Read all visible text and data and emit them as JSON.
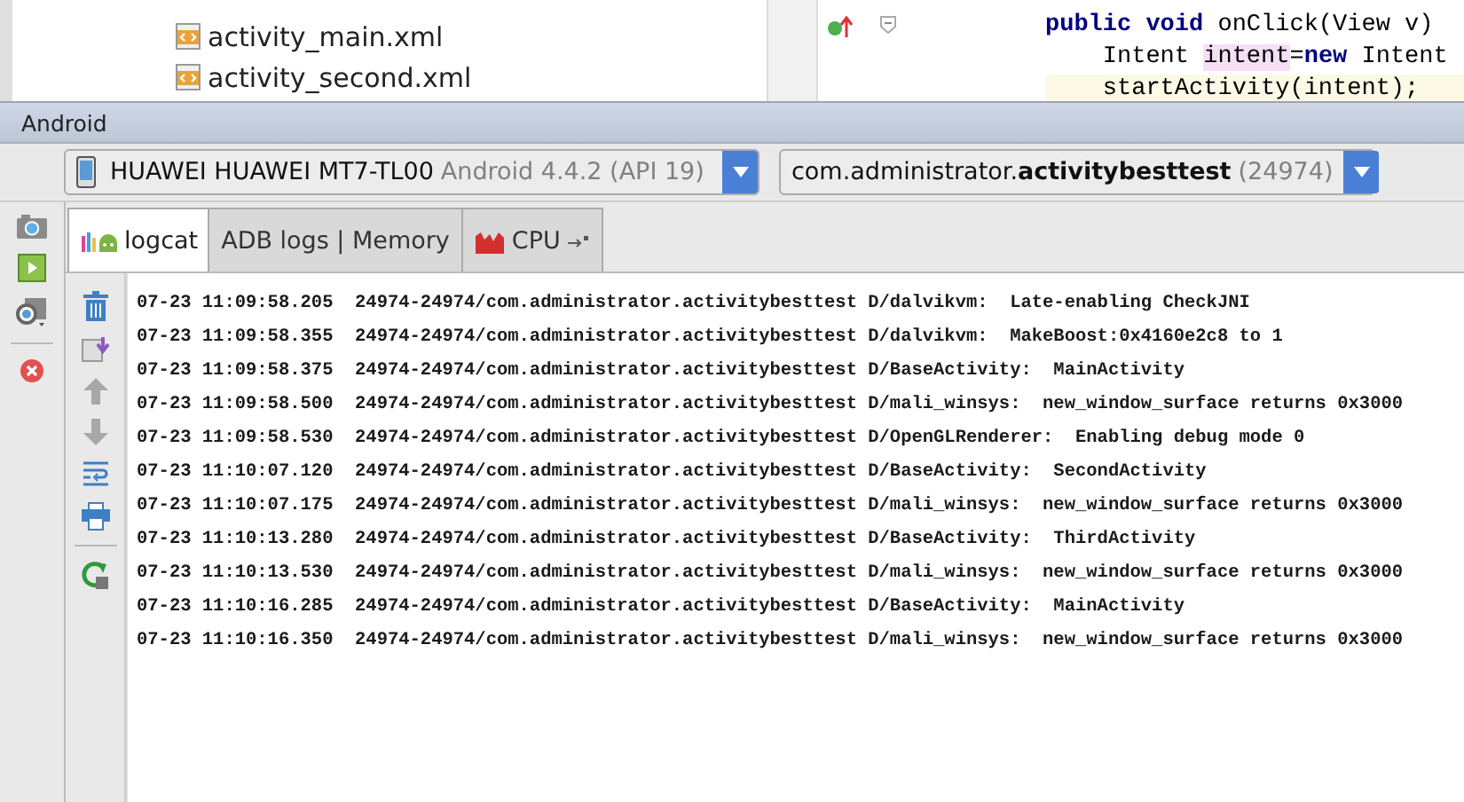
{
  "project_tree": {
    "items": [
      {
        "label": "activity_main.xml",
        "kind": "xml"
      },
      {
        "label": "activity_second.xml",
        "kind": "xml"
      }
    ]
  },
  "editor": {
    "lines": [
      {
        "parts": [
          {
            "text": "public void",
            "kind": "keyword"
          },
          {
            "text": " onClick(View v)",
            "kind": "plain"
          }
        ],
        "highlighted": false
      },
      {
        "parts": [
          {
            "text": "    Intent ",
            "kind": "plain"
          },
          {
            "text": "intent",
            "kind": "mark"
          },
          {
            "text": "=",
            "kind": "plain"
          },
          {
            "text": "new",
            "kind": "keyword"
          },
          {
            "text": " Intent",
            "kind": "plain"
          }
        ],
        "highlighted": false
      },
      {
        "parts": [
          {
            "text": "    startActivity(intent);",
            "kind": "plain"
          }
        ],
        "highlighted": true
      }
    ]
  },
  "tool_window": {
    "title": "Android",
    "device": {
      "name": "HUAWEI HUAWEI MT7-TL00",
      "detail": "Android 4.4.2 (API 19)"
    },
    "process": {
      "name": "com.administrator.**activitybesttest**",
      "pid": "(24974)"
    },
    "tabs": [
      {
        "label": "logcat",
        "kind": "logcat",
        "selected": true
      },
      {
        "label": "ADB logs | Memory",
        "kind": "plain",
        "selected": false
      },
      {
        "label": "CPU",
        "kind": "cpu",
        "selected": false
      }
    ],
    "log_lines": [
      "07-23 11:09:58.205  24974-24974/com.administrator.activitybesttest D/dalvikvm:  Late-enabling CheckJNI",
      "07-23 11:09:58.355  24974-24974/com.administrator.activitybesttest D/dalvikvm:  MakeBoost:0x4160e2c8 to 1",
      "07-23 11:09:58.375  24974-24974/com.administrator.activitybesttest D/BaseActivity:  MainActivity",
      "07-23 11:09:58.500  24974-24974/com.administrator.activitybesttest D/mali_winsys:  new_window_surface returns 0x3000",
      "07-23 11:09:58.530  24974-24974/com.administrator.activitybesttest D/OpenGLRenderer:  Enabling debug mode 0",
      "07-23 11:10:07.120  24974-24974/com.administrator.activitybesttest D/BaseActivity:  SecondActivity",
      "07-23 11:10:07.175  24974-24974/com.administrator.activitybesttest D/mali_winsys:  new_window_surface returns 0x3000",
      "07-23 11:10:13.280  24974-24974/com.administrator.activitybesttest D/BaseActivity:  ThirdActivity",
      "07-23 11:10:13.530  24974-24974/com.administrator.activitybesttest D/mali_winsys:  new_window_surface returns 0x3000",
      "07-23 11:10:16.285  24974-24974/com.administrator.activitybesttest D/BaseActivity:  MainActivity",
      "07-23 11:10:16.350  24974-24974/com.administrator.activitybesttest D/mali_winsys:  new_window_surface returns 0x3000"
    ]
  }
}
